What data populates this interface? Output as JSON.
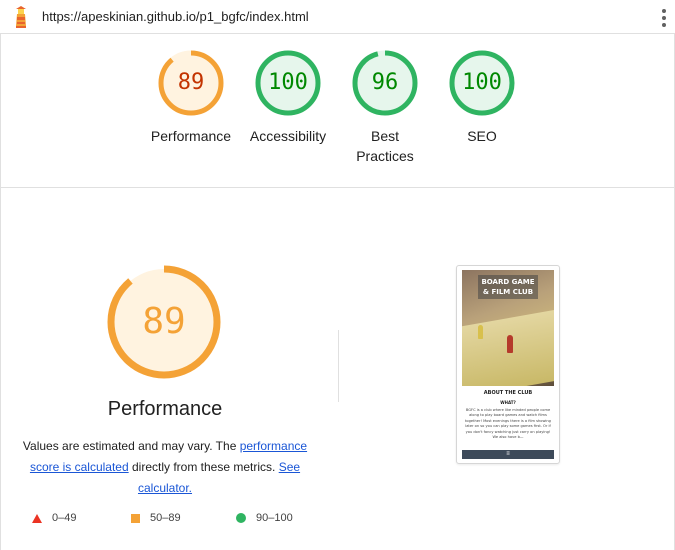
{
  "topbar": {
    "url": "https://apeskinian.github.io/p1_bgfc/index.html",
    "menu_icon": "kebab-menu-icon",
    "logo_icon": "lighthouse-icon"
  },
  "categories": [
    {
      "label": "Performance",
      "score": 89,
      "color": "#f4a236",
      "text_color": "#c33300"
    },
    {
      "label": "Accessibility",
      "score": 100,
      "color": "#2fb461",
      "text_color": "#008800"
    },
    {
      "label": "Best Practices",
      "score": 96,
      "color": "#2fb461",
      "text_color": "#008800"
    },
    {
      "label": "SEO",
      "score": 100,
      "color": "#2fb461",
      "text_color": "#008800"
    }
  ],
  "performance": {
    "score": 89,
    "title": "Performance",
    "desc_prefix": "Values are estimated and may vary. The ",
    "desc_link1": "performance score is calculated",
    "desc_middle": " directly from these metrics. ",
    "desc_link2": "See calculator."
  },
  "legend": [
    {
      "range": "0–49",
      "icon": "triangle-fail-icon",
      "color": "#eb3323"
    },
    {
      "range": "50–89",
      "icon": "square-average-icon",
      "color": "#f4a236"
    },
    {
      "range": "90–100",
      "icon": "circle-pass-icon",
      "color": "#2fb461"
    }
  ],
  "screenshot": {
    "hero_title": "BOARD GAME & FILM CLUB",
    "heading": "ABOUT THE CLUB",
    "subheading": "WHAT?",
    "body": "BGFC is a club where like minded people come along to play board games and watch films together! Most evenings there is a film showing later on so you can play some games first. Or if you don't fancy watching just carry on playing! We also have b—",
    "nav_icon": "hamburger-menu-icon",
    "nav_glyph": "≡"
  }
}
